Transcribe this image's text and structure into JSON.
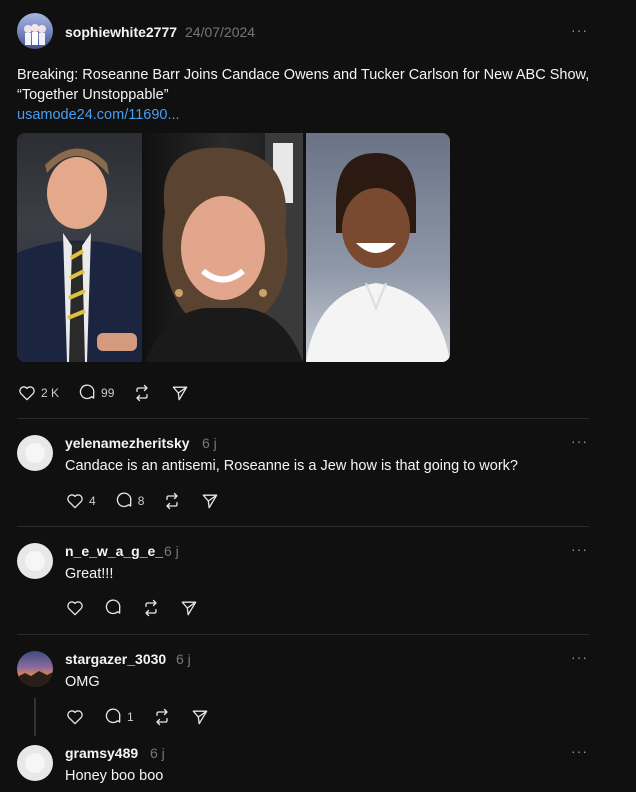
{
  "post": {
    "username": "sophiewhite2777",
    "timestamp": "24/07/2024",
    "more": "···",
    "text": "Breaking: Roseanne Barr Joins Candace Owens and Tucker Carlson for New ABC Show, “Together Unstoppable”",
    "link": "usamode24.com/11690...",
    "likes": "2 K",
    "comments": "99"
  },
  "replies": [
    {
      "username": "yelenamezheritsky",
      "time": "6 j",
      "text": "Candace is an antisemi, Roseanne is a Jew how is that going to work?",
      "likes": "4",
      "comments": "8",
      "more": "···"
    },
    {
      "username": "n_e_w_a_g_e_",
      "time": "6 j",
      "text": "Great!!!",
      "likes": "",
      "comments": "",
      "more": "···"
    },
    {
      "username": "stargazer_3030",
      "time": "6 j",
      "text": "OMG",
      "likes": "",
      "comments": "1",
      "more": "···"
    },
    {
      "username": "gramsy489",
      "time": "6 j",
      "text": "Honey boo boo",
      "more": "···"
    }
  ],
  "icons": {
    "like": "heart-icon",
    "comment": "comment-icon",
    "repost": "repost-icon",
    "share": "send-icon"
  }
}
